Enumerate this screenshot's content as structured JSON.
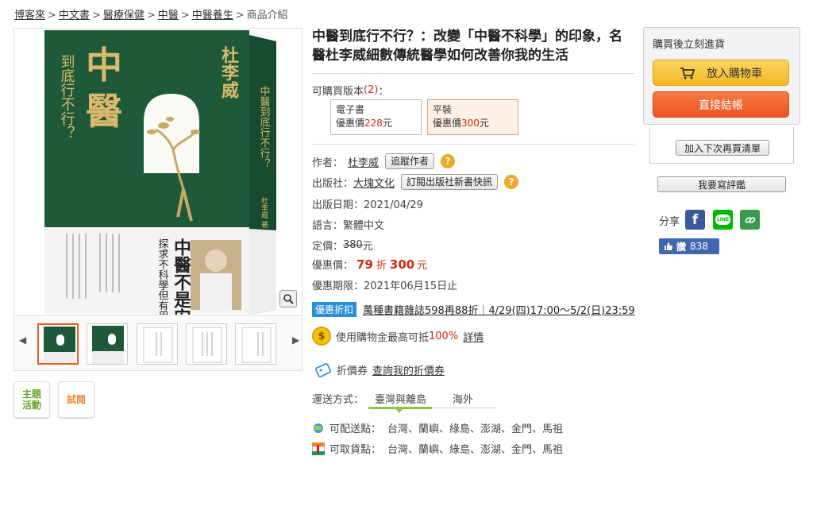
{
  "breadcrumb": {
    "items": [
      "博客來",
      "中文書",
      "醫療保健",
      "中醫",
      "中醫養生"
    ],
    "current": "商品介紹",
    "separator": ">"
  },
  "book": {
    "title": "中醫到底行不行？：改變「中醫不科學」的印象，名醫杜李威細數傳統醫學如何改善你我的生活",
    "cover": {
      "big_title_1": "中",
      "big_title_2": "醫",
      "side_title": "到底行不行？",
      "author_vertical": "杜李威",
      "spine_title": "中醫到底行不行？",
      "slogan": "中醫不是安慰劑！",
      "subtitle": "探求不科學但有用的中醫之道",
      "spine_author": "杜李威 著"
    }
  },
  "side_buttons": {
    "theme_label": "主題活動",
    "trial_label": "試閱"
  },
  "versions": {
    "label": "可購買版本",
    "count": "(2)",
    "colon": "：",
    "items": [
      {
        "name": "電子書",
        "price_prefix": "優惠價",
        "price": "228",
        "unit": "元"
      },
      {
        "name": "平裝",
        "price_prefix": "優惠價",
        "price": "300",
        "unit": "元"
      }
    ]
  },
  "details": {
    "author_label": "作者：",
    "author": "杜李威",
    "follow_author": "追蹤作者",
    "publisher_label": "出版社：",
    "publisher": "大塊文化",
    "subscribe_publisher": "訂閱出版社新書快訊",
    "help": "?",
    "date": "出版日期：2021/04/29",
    "language": "語言：繁體中文",
    "list_price_label": "定價：",
    "list_price": "380",
    "list_price_unit": "元",
    "sale_label": "優惠價：",
    "discount": "79",
    "discount_unit": "折",
    "sale_price": "300",
    "sale_unit": "元",
    "deadline": "優惠期限：2021年06月15日止"
  },
  "promo": {
    "badge": "優惠折扣",
    "text": "萬種書籍雜誌598再88折｜4/29(四)17:00～5/2(日)23:59"
  },
  "coins": {
    "text_before": "使用購物金最高可抵",
    "percent": "100%",
    "detail": "詳情"
  },
  "coupon": {
    "label": "折價券",
    "link": "查詢我的折價券"
  },
  "shipping": {
    "label": "運送方式：",
    "tabs": [
      "臺灣與離島",
      "海外"
    ],
    "delivery_label": "可配送點：",
    "delivery_places": "台灣、蘭嶼、綠島、澎湖、金門、馬祖",
    "pickup_label": "可取貨點：",
    "pickup_places": "台灣、蘭嶼、綠島、澎湖、金門、馬祖"
  },
  "purchase": {
    "title": "購買後立刻進貨",
    "cart": "放入購物車",
    "checkout": "直接結帳",
    "wishlist": "加入下次再買清單",
    "review": "我要寫評鑑"
  },
  "share": {
    "label": "分享",
    "like_label": "讚",
    "like_count": "838",
    "line_text": "LINE"
  },
  "colors": {
    "accent_red": "#d12b0f",
    "cover_green": "#1e5a3a",
    "cart_yellow": "#f5b822",
    "checkout_orange": "#ec5420"
  }
}
